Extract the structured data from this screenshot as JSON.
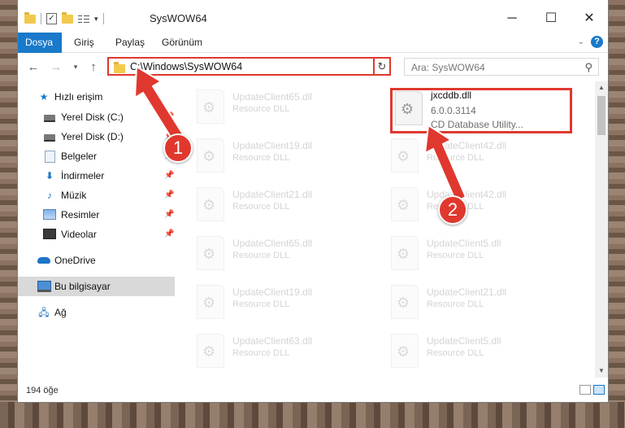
{
  "window": {
    "title": "SysWOW64",
    "minimize_glyph": "─",
    "maximize_glyph": "☐",
    "close_glyph": "✕"
  },
  "ribbon": {
    "tabs": [
      "Dosya",
      "Giriş",
      "Paylaş",
      "Görünüm"
    ]
  },
  "address": {
    "path": "C:\\Windows\\SysWOW64",
    "search_placeholder": "Ara: SysWOW64"
  },
  "sidebar": {
    "items": [
      {
        "label": "Hızlı erişim",
        "icon": "star-icon"
      },
      {
        "label": "Yerel Disk (C:)",
        "icon": "drive-icon",
        "pinned": true
      },
      {
        "label": "Yerel Disk (D:)",
        "icon": "drive-icon",
        "pinned": true
      },
      {
        "label": "Belgeler",
        "icon": "documents-icon",
        "pinned": true
      },
      {
        "label": "İndirmeler",
        "icon": "download-icon",
        "pinned": true
      },
      {
        "label": "Müzik",
        "icon": "music-icon",
        "pinned": true
      },
      {
        "label": "Resimler",
        "icon": "pictures-icon",
        "pinned": true
      },
      {
        "label": "Videolar",
        "icon": "videos-icon",
        "pinned": true
      },
      {
        "label": "OneDrive",
        "icon": "cloud-icon"
      },
      {
        "label": "Bu bilgisayar",
        "icon": "computer-icon",
        "selected": true
      },
      {
        "label": "Ağ",
        "icon": "network-icon"
      }
    ]
  },
  "files": {
    "highlighted": {
      "name": "jxcddb.dll",
      "version": "6.0.0.3114",
      "description": "CD Database Utility..."
    },
    "left_column": [
      {
        "name": "UpdateClient65.dll",
        "desc": "Resource DLL"
      },
      {
        "name": "UpdateClient19.dll",
        "desc": "Resource DLL"
      },
      {
        "name": "UpdateClient21.dll",
        "desc": "Resource DLL"
      },
      {
        "name": "UpdateClient65.dll",
        "desc": "Resource DLL"
      },
      {
        "name": "UpdateClient19.dll",
        "desc": "Resource DLL"
      },
      {
        "name": "UpdateClient63.dll",
        "desc": "Resource DLL"
      }
    ],
    "right_column": [
      {
        "name": "UpdateClient42.dll",
        "desc": "Resource DLL"
      },
      {
        "name": "UpdateClient42.dll",
        "desc": "Resource DLL"
      },
      {
        "name": "UpdateClient5.dll",
        "desc": "Resource DLL"
      },
      {
        "name": "UpdateClient21.dll",
        "desc": "Resource DLL"
      },
      {
        "name": "UpdateClient5.dll",
        "desc": "Resource DLL"
      }
    ]
  },
  "status": {
    "item_count": "194 öğe"
  },
  "annotations": {
    "step1": "1",
    "step2": "2",
    "color": "#e0382e"
  }
}
